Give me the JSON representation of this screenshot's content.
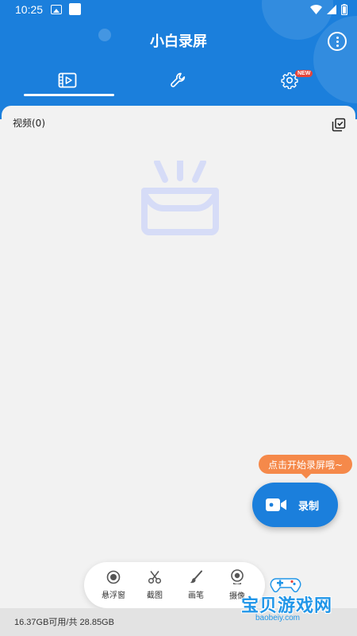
{
  "status_bar": {
    "time": "10:25",
    "icons": [
      "gallery-icon",
      "app-square-icon",
      "wifi-icon",
      "signal-icon",
      "battery-icon"
    ]
  },
  "app": {
    "title": "小白录屏"
  },
  "tabs": [
    {
      "icon": "video-film-icon",
      "active": true
    },
    {
      "icon": "wrench-icon",
      "active": false
    },
    {
      "icon": "gear-icon",
      "active": false,
      "badge": "NEW"
    }
  ],
  "content": {
    "video_section_label": "视频(0)",
    "empty_state_icon": "empty-box-icon"
  },
  "record": {
    "tooltip": "点击开始录屏哦~",
    "button_label": "录制"
  },
  "toolbar": {
    "items": [
      {
        "label": "悬浮窗",
        "icon": "floating-window-icon"
      },
      {
        "label": "截图",
        "icon": "scissors-icon"
      },
      {
        "label": "画笔",
        "icon": "brush-icon"
      },
      {
        "label": "摄像",
        "icon": "camera-webcam-icon"
      }
    ]
  },
  "footer": {
    "storage": "16.37GB可用/共 28.85GB"
  },
  "watermark": {
    "text": "宝贝游戏网",
    "url": "baobeiy.com"
  },
  "colors": {
    "primary": "#1b7fdc",
    "accent_orange": "#f5894a",
    "badge_red": "#e6453a",
    "empty_icon": "#d6dcf7"
  }
}
